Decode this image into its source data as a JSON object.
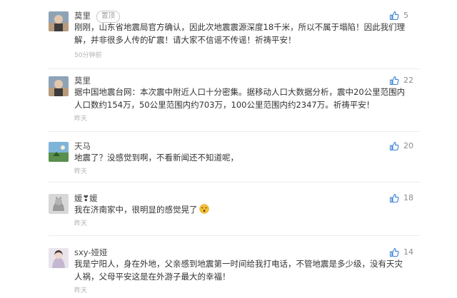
{
  "comments": [
    {
      "username": "莫里",
      "tag": "置顶",
      "likes": "5",
      "text": "刚刚，山东省地震局官方确认，因此次地震震源深度18千米，所以不属于塌陷！因此我们理解，并非很多人传的矿震！请大家不信谣不传谣！祈祷平安！",
      "time": "50分钟前"
    },
    {
      "username": "莫里",
      "likes": "22",
      "text": "据中国地震台网：本次震中附近人口十分密集。据移动人口大数据分析，震中20公里范围内人口数约154万，50公里范围内约703万，100公里范围内约2347万。祈祷平安！",
      "time": "昨天"
    },
    {
      "username": "天马",
      "likes": "20",
      "text": "地震了？没感觉到啊，不看新闻还不知道呢，",
      "time": "昨天"
    },
    {
      "username": "媛❣媛",
      "likes": "18",
      "text": "我在济南家中，很明显的感觉晃了",
      "time": "昨天"
    },
    {
      "username": "sxy-娅娅",
      "likes": "14",
      "text": "我是宁阳人，身在外地，父亲感到地震第一时间给我打电话，不管地震是多少级，没有天灾人祸，父母平安这是在外游子最大的幸福！",
      "time": "昨天"
    }
  ],
  "colors": {
    "accent": "#3b82d6",
    "text": "#333333",
    "meta": "#b0b0b0"
  },
  "icons": {
    "like": "thumbs-up-icon",
    "emoji": "dizzy-face-emoji"
  }
}
